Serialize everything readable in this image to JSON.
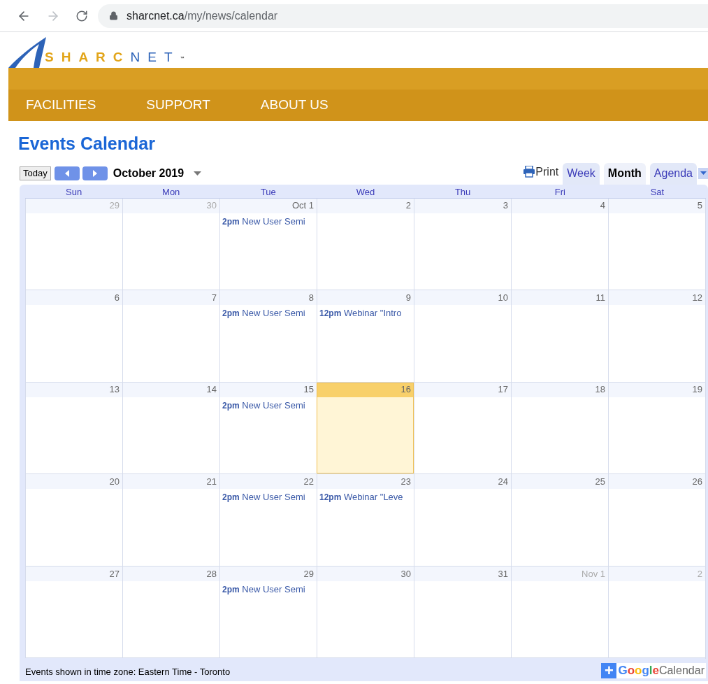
{
  "browser": {
    "url_host": "sharcnet.ca",
    "url_path": "/my/news/calendar"
  },
  "logo": {
    "part_1": "SHARC",
    "part_2": "NET",
    "mark": "™"
  },
  "nav": [
    "FACILITIES",
    "SUPPORT",
    "ABOUT US"
  ],
  "title": "Events Calendar",
  "toolbar": {
    "today": "Today",
    "month": "October 2019",
    "print": "Print"
  },
  "tabs": [
    {
      "label": "Week",
      "selected": false
    },
    {
      "label": "Month",
      "selected": true
    },
    {
      "label": "Agenda",
      "selected": false
    }
  ],
  "weekdays": [
    "Sun",
    "Mon",
    "Tue",
    "Wed",
    "Thu",
    "Fri",
    "Sat"
  ],
  "weeks": [
    [
      {
        "date": "29",
        "other_month": true,
        "today": false
      },
      {
        "date": "30",
        "other_month": true,
        "today": false
      },
      {
        "date": "Oct 1",
        "other_month": false,
        "today": false,
        "events": [
          {
            "time": "2pm",
            "title": "New User Semi"
          }
        ]
      },
      {
        "date": "2",
        "other_month": false,
        "today": false
      },
      {
        "date": "3",
        "other_month": false,
        "today": false
      },
      {
        "date": "4",
        "other_month": false,
        "today": false
      },
      {
        "date": "5",
        "other_month": false,
        "today": false
      }
    ],
    [
      {
        "date": "6",
        "other_month": false,
        "today": false
      },
      {
        "date": "7",
        "other_month": false,
        "today": false
      },
      {
        "date": "8",
        "other_month": false,
        "today": false,
        "events": [
          {
            "time": "2pm",
            "title": "New User Semi"
          }
        ]
      },
      {
        "date": "9",
        "other_month": false,
        "today": false,
        "events": [
          {
            "time": "12pm",
            "title": "Webinar \"Intro"
          }
        ]
      },
      {
        "date": "10",
        "other_month": false,
        "today": false
      },
      {
        "date": "11",
        "other_month": false,
        "today": false
      },
      {
        "date": "12",
        "other_month": false,
        "today": false
      }
    ],
    [
      {
        "date": "13",
        "other_month": false,
        "today": false
      },
      {
        "date": "14",
        "other_month": false,
        "today": false
      },
      {
        "date": "15",
        "other_month": false,
        "today": false,
        "events": [
          {
            "time": "2pm",
            "title": "New User Semi"
          }
        ]
      },
      {
        "date": "16",
        "other_month": false,
        "today": true
      },
      {
        "date": "17",
        "other_month": false,
        "today": false
      },
      {
        "date": "18",
        "other_month": false,
        "today": false
      },
      {
        "date": "19",
        "other_month": false,
        "today": false
      }
    ],
    [
      {
        "date": "20",
        "other_month": false,
        "today": false
      },
      {
        "date": "21",
        "other_month": false,
        "today": false
      },
      {
        "date": "22",
        "other_month": false,
        "today": false,
        "events": [
          {
            "time": "2pm",
            "title": "New User Semi"
          }
        ]
      },
      {
        "date": "23",
        "other_month": false,
        "today": false,
        "events": [
          {
            "time": "12pm",
            "title": "Webinar \"Leve"
          }
        ]
      },
      {
        "date": "24",
        "other_month": false,
        "today": false
      },
      {
        "date": "25",
        "other_month": false,
        "today": false
      },
      {
        "date": "26",
        "other_month": false,
        "today": false
      }
    ],
    [
      {
        "date": "27",
        "other_month": false,
        "today": false
      },
      {
        "date": "28",
        "other_month": false,
        "today": false
      },
      {
        "date": "29",
        "other_month": false,
        "today": false,
        "events": [
          {
            "time": "2pm",
            "title": "New User Semi"
          }
        ]
      },
      {
        "date": "30",
        "other_month": false,
        "today": false
      },
      {
        "date": "31",
        "other_month": false,
        "today": false
      },
      {
        "date": "Nov 1",
        "other_month": true,
        "today": false
      },
      {
        "date": "2",
        "other_month": true,
        "today": false
      }
    ]
  ],
  "footer": {
    "timezone": "Events shown in time zone: Eastern Time - Toronto",
    "badge_plus": "+",
    "badge_brand": "Google",
    "badge_product": "Calendar"
  }
}
